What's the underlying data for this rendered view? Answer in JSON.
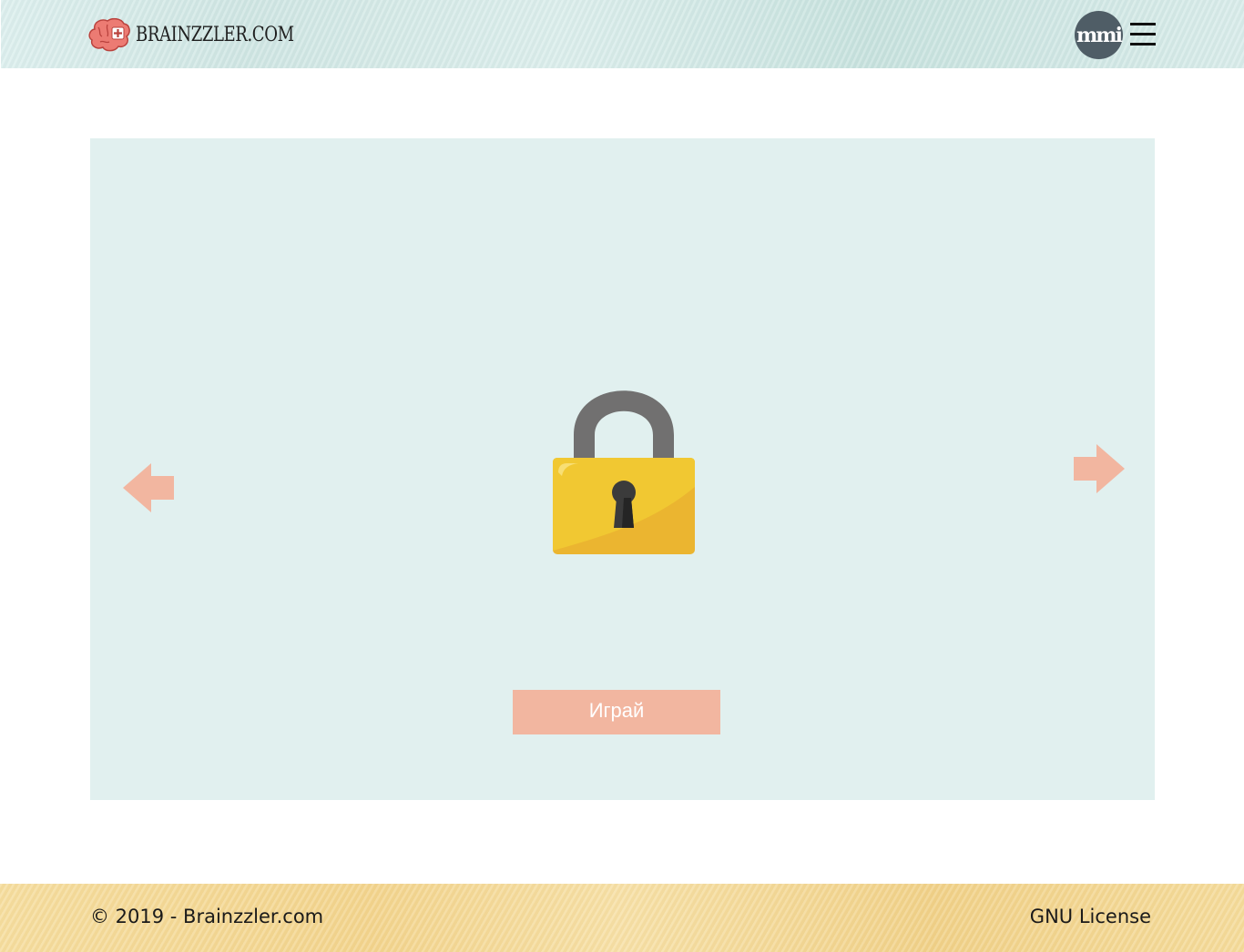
{
  "header": {
    "logo_text": "BRAINZZLER.COM",
    "badge_text": "mmi",
    "menu_icon": "hamburger-icon"
  },
  "game": {
    "locked_icon": "padlock-icon",
    "prev_icon": "arrow-left-icon",
    "next_icon": "arrow-right-icon",
    "play_label": "Играй"
  },
  "footer": {
    "copyright": "© 2019 - Brainzzler.com",
    "license": "GNU License"
  },
  "colors": {
    "accent": "#f2b6a0",
    "panel_bg": "#e1f0ef",
    "lock_body": "#f1c832",
    "lock_shackle": "#717070"
  }
}
